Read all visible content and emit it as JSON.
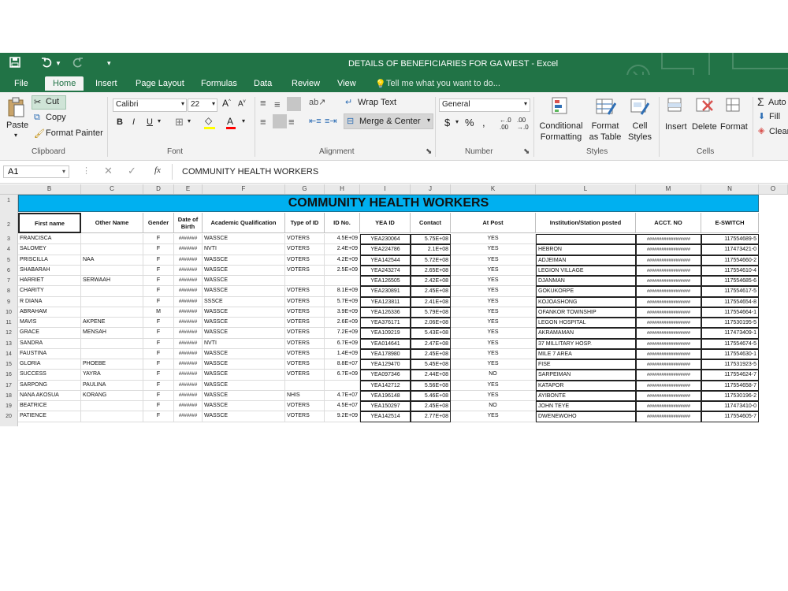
{
  "window": {
    "title": "DETAILS OF BENEFICIARIES FOR GA WEST - Excel"
  },
  "colors": {
    "excel_green": "#217346",
    "banner_blue": "#00b0f0"
  },
  "menu": [
    "File",
    "Home",
    "Insert",
    "Page Layout",
    "Formulas",
    "Data",
    "Review",
    "View"
  ],
  "tell_me": "Tell me what you want to do...",
  "ribbon": {
    "paste": "Paste",
    "cut": "Cut",
    "copy": "Copy",
    "format_painter": "Format Painter",
    "clipboard": "Clipboard",
    "font_name": "Calibri",
    "font_size": "22",
    "font": "Font",
    "wrap_text": "Wrap Text",
    "merge_center": "Merge & Center",
    "alignment": "Alignment",
    "number_format": "General",
    "number": "Number",
    "conditional_formatting": "Conditional Formatting",
    "format_as_table": "Format as Table",
    "cell_styles": "Cell Styles",
    "styles": "Styles",
    "insert": "Insert",
    "delete": "Delete",
    "format": "Format",
    "cells": "Cells",
    "autosum": "Auto",
    "fill": "Fill",
    "clear": "Clear"
  },
  "formula_bar": {
    "name_box": "A1",
    "fx": "fx",
    "content": "COMMUNITY HEALTH WORKERS"
  },
  "columns": [
    "B",
    "C",
    "D",
    "E",
    "F",
    "G",
    "H",
    "I",
    "J",
    "K",
    "L",
    "M",
    "N",
    "O"
  ],
  "sheet": {
    "banner": "COMMUNITY HEALTH WORKERS",
    "headers": [
      "First name",
      "Other Name",
      "Gender",
      "Date of Birth",
      "Academic Qualification",
      "Type of ID",
      "ID No.",
      "YEA ID",
      "Contact",
      "At Post",
      "Institution/Station posted",
      "ACCT. NO",
      "E-SWITCH"
    ],
    "rows": [
      {
        "n": "3",
        "c": [
          "FRANCISCA",
          "",
          "F",
          "#######",
          "WASSCE",
          "VOTERS",
          "4.5E+09",
          "YEA230064",
          "5.75E+08",
          "YES",
          "",
          "##################",
          "117554689-5"
        ]
      },
      {
        "n": "4",
        "c": [
          "SALOMEY",
          "",
          "F",
          "#######",
          "NVTI",
          "VOTERS",
          "2.4E+09",
          "YEA224786",
          "2.1E+08",
          "YES",
          "HEBRON",
          "##################",
          "117473421-0"
        ]
      },
      {
        "n": "5",
        "c": [
          "PRISCILLA",
          "NAA",
          "F",
          "#######",
          "WASSCE",
          "VOTERS",
          "4.2E+09",
          "YEA142544",
          "5.72E+08",
          "YES",
          "ADJEIMAN",
          "##################",
          "117554660-2"
        ]
      },
      {
        "n": "6",
        "c": [
          "SHABARAH",
          "",
          "F",
          "#######",
          "WASSCE",
          "VOTERS",
          "2.5E+09",
          "YEA243274",
          "2.65E+08",
          "YES",
          "LEGION VILLAGE",
          "##################",
          "117554610-4"
        ]
      },
      {
        "n": "7",
        "c": [
          "HARRIET",
          "SERWAAH",
          "F",
          "#######",
          "WASSCE",
          "",
          "",
          "YEA126505",
          "2.42E+08",
          "YES",
          "DJANMAN",
          "##################",
          "117554685-6"
        ]
      },
      {
        "n": "8",
        "c": [
          "CHARITY",
          "",
          "F",
          "#######",
          "WASSCE",
          "VOTERS",
          "8.1E+09",
          "YEA230891",
          "2.45E+08",
          "YES",
          "GOKUKORPE",
          "##################",
          "117554617-5"
        ]
      },
      {
        "n": "9",
        "c": [
          "R DIANA",
          "",
          "F",
          "#######",
          "SSSCE",
          "VOTERS",
          "5.7E+09",
          "YEA123811",
          "2.41E+08",
          "YES",
          "KOJOASHONG",
          "##################",
          "117554654-8"
        ]
      },
      {
        "n": "10",
        "c": [
          "ABRAHAM",
          "",
          "M",
          "#######",
          "WASSCE",
          "VOTERS",
          "3.9E+09",
          "YEA126336",
          "5.79E+08",
          "YES",
          "OFANKOR TOWNSHIP",
          "##################",
          "117554664-1"
        ]
      },
      {
        "n": "11",
        "c": [
          "MAVIS",
          "AKPENE",
          "F",
          "#######",
          "WASSCE",
          "VOTERS",
          "2.6E+09",
          "YEA376171",
          "2.06E+08",
          "YES",
          "LEGON HOSPITAL",
          "##################",
          "117530195-5"
        ]
      },
      {
        "n": "12",
        "c": [
          "GRACE",
          "MENSAH",
          "F",
          "#######",
          "WASSCE",
          "VOTERS",
          "7.2E+09",
          "YEA109219",
          "5.43E+08",
          "YES",
          "AKRAMAMAN",
          "##################",
          "117473409-1"
        ]
      },
      {
        "n": "13",
        "c": [
          "SANDRA",
          "",
          "F",
          "#######",
          "NVTI",
          "VOTERS",
          "6.7E+09",
          "YEA014641",
          "2.47E+08",
          "YES",
          "37 MILLITARY HOSP.",
          "##################",
          "117554674-5"
        ]
      },
      {
        "n": "14",
        "c": [
          "FAUSTINA",
          "",
          "F",
          "#######",
          "WASSCE",
          "VOTERS",
          "1.4E+09",
          "YEA178980",
          "2.45E+08",
          "YES",
          "MILE 7 AREA",
          "##################",
          "117554630-1"
        ]
      },
      {
        "n": "15",
        "c": [
          "GLORIA",
          "PHOEBE",
          "F",
          "#######",
          "WASSCE",
          "VOTERS",
          "8.8E+07",
          "YEA129470",
          "5.45E+08",
          "YES",
          "FISE",
          "##################",
          "117531923-5"
        ]
      },
      {
        "n": "16",
        "c": [
          "SUCCESS",
          "YAYRA",
          "F",
          "#######",
          "WASSCE",
          "VOTERS",
          "6.7E+09",
          "YEA097346",
          "2.44E+08",
          "NO",
          "SARPEIMAN",
          "##################",
          "117554624-7"
        ]
      },
      {
        "n": "17",
        "c": [
          "SARPONG",
          "PAULINA",
          "F",
          "#######",
          "WASSCE",
          "",
          "",
          "YEA142712",
          "5.56E+08",
          "YES",
          "KATAPOR",
          "##################",
          "117554658-7"
        ]
      },
      {
        "n": "18",
        "c": [
          "NANA AKOSUA",
          "KORANG",
          "F",
          "#######",
          "WASSCE",
          "NHIS",
          "4.7E+07",
          "YEA196148",
          "5.46E+08",
          "YES",
          "AYIBONTE",
          "##################",
          "117530196-2"
        ]
      },
      {
        "n": "19",
        "c": [
          "BEATRICE",
          "",
          "F",
          "#######",
          "WASSCE",
          "VOTERS",
          "4.5E+07",
          "YEA150297",
          "2.45E+08",
          "NO",
          "JOHN TEYE",
          "##################",
          "117473410-0"
        ]
      },
      {
        "n": "20",
        "c": [
          "PATIENCE",
          "",
          "F",
          "#######",
          "WASSCE",
          "VOTERS",
          "9.2E+09",
          "YEA142514",
          "2.77E+08",
          "YES",
          "DWENEWOHO",
          "##################",
          "117554605-7"
        ]
      }
    ]
  }
}
